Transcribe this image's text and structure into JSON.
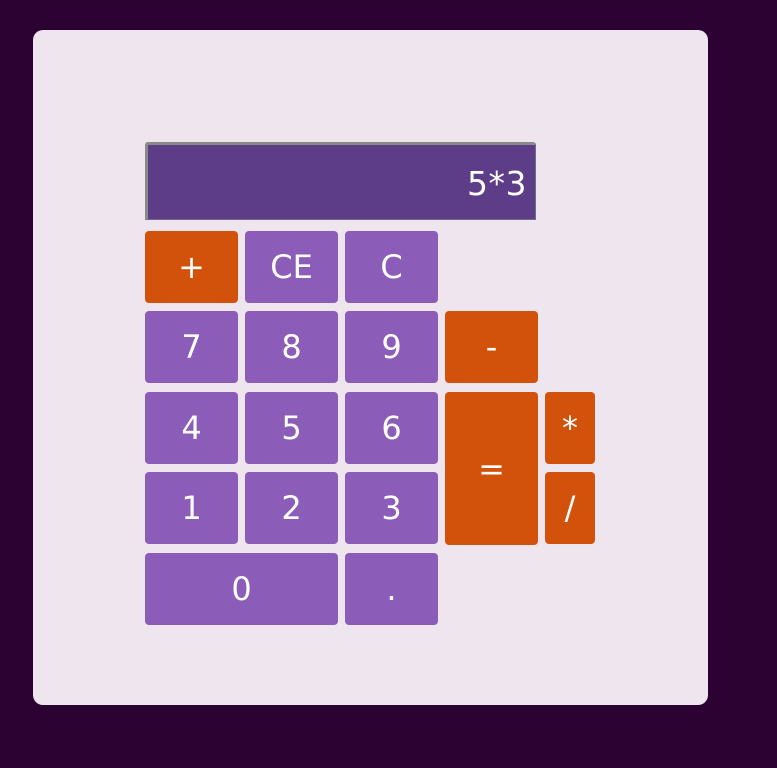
{
  "display": {
    "value": "5*3"
  },
  "keys": {
    "plus": "+",
    "ce": "CE",
    "clear": "C",
    "seven": "7",
    "eight": "8",
    "nine": "9",
    "minus": "-",
    "four": "4",
    "five": "5",
    "six": "6",
    "equals": "=",
    "multiply": "*",
    "one": "1",
    "two": "2",
    "three": "3",
    "divide": "/",
    "zero": "0",
    "decimal": "."
  },
  "colors": {
    "page_background": "#2b0231",
    "card_background": "#efe5ef",
    "display_background": "#5d3d88",
    "number_key": "#8c5db8",
    "operator_key": "#d2520b",
    "key_text": "#ffffff"
  }
}
